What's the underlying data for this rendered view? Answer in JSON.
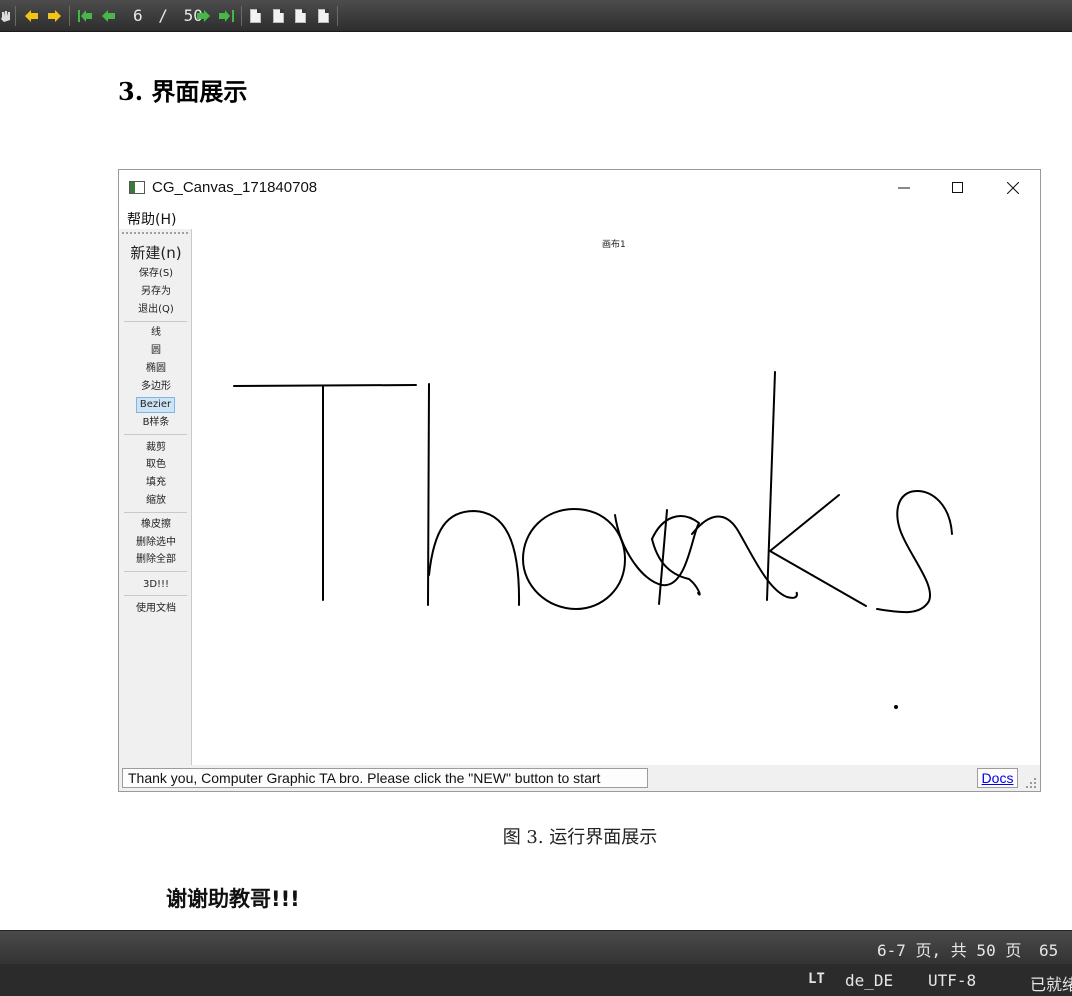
{
  "toolbar": {
    "page_current": "6",
    "page_separator": "/",
    "page_total": "50",
    "icons": [
      "hand-icon",
      "back-icon",
      "forward-icon",
      "first-page-icon",
      "prev-page-icon",
      "next-page-icon",
      "last-page-icon",
      "zoom-100-icon",
      "fit-page-icon",
      "fit-width-icon",
      "fit-content-icon"
    ]
  },
  "document": {
    "section_heading": "3. 界面展示",
    "caption": "图 3. 运行界面展示",
    "closing_text": "谢谢助教哥!!!"
  },
  "app_window": {
    "title": "CG_Canvas_171840708",
    "menu_help": "帮助(H)",
    "sidebar": {
      "group_file": [
        "新建(n)",
        "保存(S)",
        "另存为",
        "退出(Q)"
      ],
      "group_draw": [
        "线",
        "圆",
        "椭圆",
        "多边形",
        "Bezier",
        "B样条"
      ],
      "group_edit": [
        "裁剪",
        "取色",
        "填充",
        "缩放"
      ],
      "group_delete": [
        "橡皮擦",
        "删除选中",
        "删除全部"
      ],
      "group_3d": [
        "3D!!!"
      ],
      "group_docs": [
        "使用文档"
      ]
    },
    "canvas_tab": "画布1",
    "status_message": "Thank you, Computer Graphic TA bro. Please click the \"NEW\" button to start",
    "docs_button": "Docs"
  },
  "status_bottom": {
    "page_range": "6-7 页, 共 50 页",
    "zoom": "65",
    "lang_icon": "LT",
    "locale": "de_DE",
    "encoding": "UTF-8",
    "state": "已就绪"
  }
}
